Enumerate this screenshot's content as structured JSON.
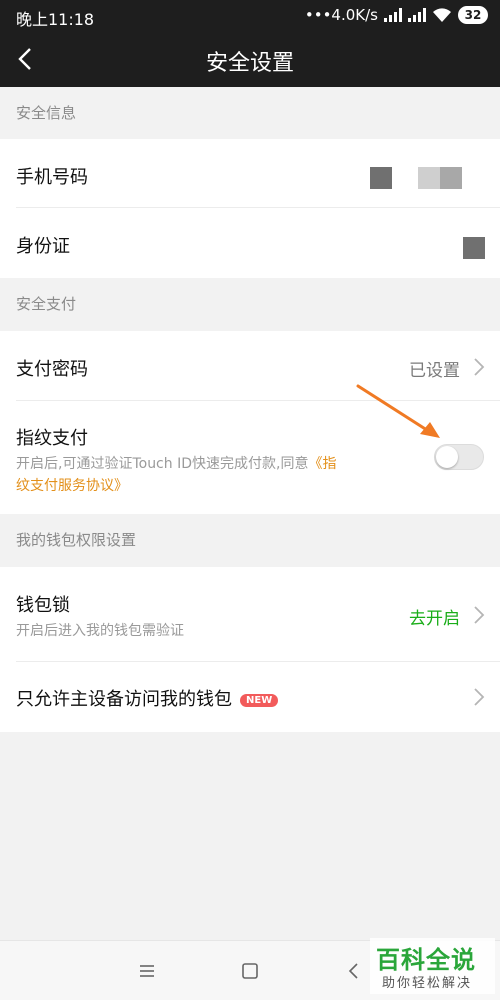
{
  "status_bar": {
    "time": "晚上11:18",
    "speed": "•••4.0K/s",
    "battery": "32"
  },
  "header": {
    "title": "安全设置"
  },
  "sections": {
    "security_info": "安全信息",
    "security_pay": "安全支付",
    "wallet_perm": "我的钱包权限设置"
  },
  "rows": {
    "phone": {
      "label": "手机号码"
    },
    "id_card": {
      "label": "身份证"
    },
    "pay_password": {
      "label": "支付密码",
      "value": "已设置"
    },
    "fingerprint": {
      "label": "指纹支付",
      "desc": "开启后,可通过验证Touch ID快速完成付款,同意",
      "link_part1": "《指",
      "link_part2": "纹支付服务协议》",
      "toggle_on": false
    },
    "wallet_lock": {
      "label": "钱包锁",
      "desc": "开启后进入我的钱包需验证",
      "value": "去开启"
    },
    "main_device": {
      "label": "只允许主设备访问我的钱包",
      "badge": "NEW"
    }
  },
  "colors": {
    "accent_green": "#1aad19",
    "link_orange": "#e3901b",
    "arrow_orange": "#f07a24",
    "badge_red": "#f25b5b"
  },
  "watermark": {
    "title": "百科全说",
    "subtitle": "助你轻松解决"
  }
}
